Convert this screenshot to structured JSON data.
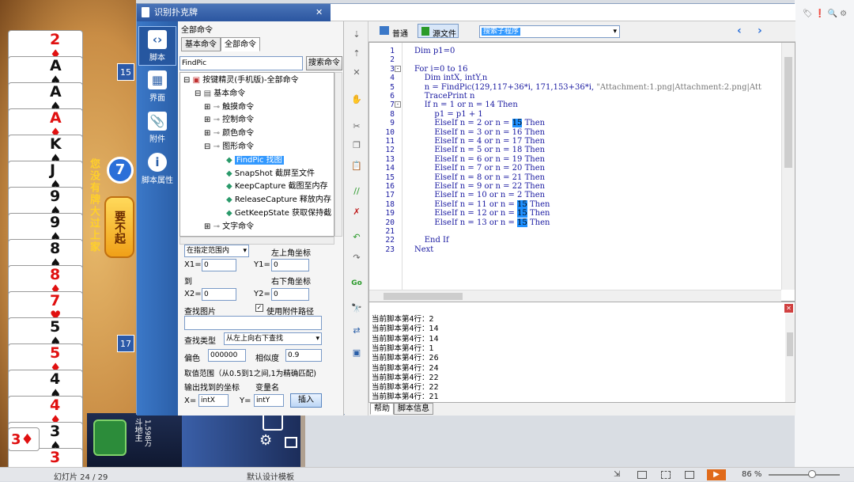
{
  "game": {
    "cards": [
      {
        "rank": "2",
        "suit": "♦",
        "color": "red"
      },
      {
        "rank": "A",
        "suit": "♠",
        "color": "blk"
      },
      {
        "rank": "A",
        "suit": "♠",
        "color": "blk"
      },
      {
        "rank": "A",
        "suit": "♦",
        "color": "red"
      },
      {
        "rank": "K",
        "suit": "♠",
        "color": "blk"
      },
      {
        "rank": "J",
        "suit": "♠",
        "color": "blk"
      },
      {
        "rank": "9",
        "suit": "♠",
        "color": "blk"
      },
      {
        "rank": "9",
        "suit": "♠",
        "color": "blk"
      },
      {
        "rank": "8",
        "suit": "♠",
        "color": "blk"
      },
      {
        "rank": "8",
        "suit": "♦",
        "color": "red"
      },
      {
        "rank": "7",
        "suit": "♥",
        "color": "red"
      },
      {
        "rank": "5",
        "suit": "♠",
        "color": "blk"
      },
      {
        "rank": "5",
        "suit": "♦",
        "color": "red"
      },
      {
        "rank": "4",
        "suit": "♠",
        "color": "blk"
      },
      {
        "rank": "4",
        "suit": "♦",
        "color": "red"
      },
      {
        "rank": "3",
        "suit": "♠",
        "color": "blk"
      },
      {
        "rank": "3",
        "suit": "♦",
        "color": "red"
      }
    ],
    "last_card": {
      "rank": "3",
      "suit": "♦"
    },
    "badge_top": "15",
    "badge_bottom": "17",
    "timer": "7",
    "pass_button": "要不起",
    "side_text": "您没有牌大过上家",
    "bottom_coins": "1,598万",
    "bottom_label": "斗地主"
  },
  "window": {
    "title": "识别扑克牌",
    "close": "✕"
  },
  "leftbar": [
    {
      "label": "脚本",
      "icon": "‹›"
    },
    {
      "label": "界面",
      "icon": "▦"
    },
    {
      "label": "附件",
      "icon": "📎"
    },
    {
      "label": "脚本属性",
      "icon": "i"
    }
  ],
  "cmdpanel": {
    "header": "全部命令",
    "tab1": "基本命令",
    "tab2": "全部命令",
    "search_value": "FindPic",
    "search_button": "搜索命令",
    "tree": [
      {
        "text": "按键精灵(手机版)-全部命令",
        "lvl": 0
      },
      {
        "text": "基本命令",
        "lvl": 1
      },
      {
        "text": "触摸命令",
        "lvl": 2
      },
      {
        "text": "控制命令",
        "lvl": 2
      },
      {
        "text": "颜色命令",
        "lvl": 2
      },
      {
        "text": "图形命令",
        "lvl": 2
      },
      {
        "text": "FindPic 找图",
        "lvl": 3,
        "sel": true
      },
      {
        "text": "SnapShot 截屏至文件",
        "lvl": 3
      },
      {
        "text": "KeepCapture 截图至内存",
        "lvl": 3
      },
      {
        "text": "ReleaseCapture 释放内存",
        "lvl": 3
      },
      {
        "text": "GetKeepState 获取保持截",
        "lvl": 3
      },
      {
        "text": "文字命令",
        "lvl": 2
      }
    ],
    "range_select": "在指定范围内",
    "top_left_label": "左上角坐标",
    "x1_label": "X1=",
    "x1_value": "0",
    "y1_label": "Y1=",
    "y1_value": "0",
    "to_label": "到",
    "bottom_right_label": "右下角坐标",
    "x2_label": "X2=",
    "x2_value": "0",
    "y2_label": "Y2=",
    "y2_value": "0",
    "find_pic_label": "查找图片",
    "use_attach_path": "使用附件路径",
    "find_type_label": "查找类型",
    "find_type_value": "从左上向右下查找",
    "offset_label": "偏色",
    "offset_value": "000000",
    "similar_label": "相似度",
    "similar_value": "0.9",
    "range_note": "取值范围（从0.5到1之间,1为精确匹配)",
    "output_coord_label": "输出找到的坐标",
    "var_name_label": "变量名",
    "x_label": "X=",
    "x_value": "intX",
    "y_label": "Y=",
    "y_value": "intY",
    "insert_button": "插入"
  },
  "editor": {
    "mode_normal": "普通",
    "mode_source": "源文件",
    "sub_search": "搜索子程序",
    "lines": [
      "Dim p1=0",
      "",
      "For i=0 to 16",
      "    Dim intX, intY,n",
      "    n = FindPic(129,117+36*i, 171,153+36*i, \"Attachment:1.png|Attachment:2.png|Att",
      "    TracePrint n",
      "    If n = 1 or n = 14 Then",
      "        p1 = p1 + 1",
      "        ElseIf n = 2 or n = 15 Then",
      "        ElseIf n = 3 or n = 16 Then",
      "        ElseIf n = 4 or n = 17 Then",
      "        ElseIf n = 5 or n = 18 Then",
      "        ElseIf n = 6 or n = 19 Then",
      "        ElseIf n = 7 or n = 20 Then",
      "        ElseIf n = 8 or n = 21 Then",
      "        ElseIf n = 9 or n = 22 Then",
      "        ElseIf n = 10 or n = 2 Then",
      "        ElseIf n = 11 or n = 15 Then",
      "        ElseIf n = 12 or n = 15 Then",
      "        ElseIf n = 13 or n = 15 Then",
      "",
      "    End If",
      "Next"
    ]
  },
  "output": {
    "lines": [
      "当前脚本第4行：2",
      "当前脚本第4行：14",
      "当前脚本第4行：14",
      "当前脚本第4行：1",
      "当前脚本第4行：26",
      "当前脚本第4行：24",
      "当前脚本第4行：22",
      "当前脚本第4行：22",
      "当前脚本第4行：21"
    ],
    "tab_help": "帮助",
    "tab_info": "脚本信息"
  },
  "statusbar": {
    "slide": "幻灯片 24 / 29",
    "template": "默认设计模板",
    "zoom": "86 %"
  }
}
